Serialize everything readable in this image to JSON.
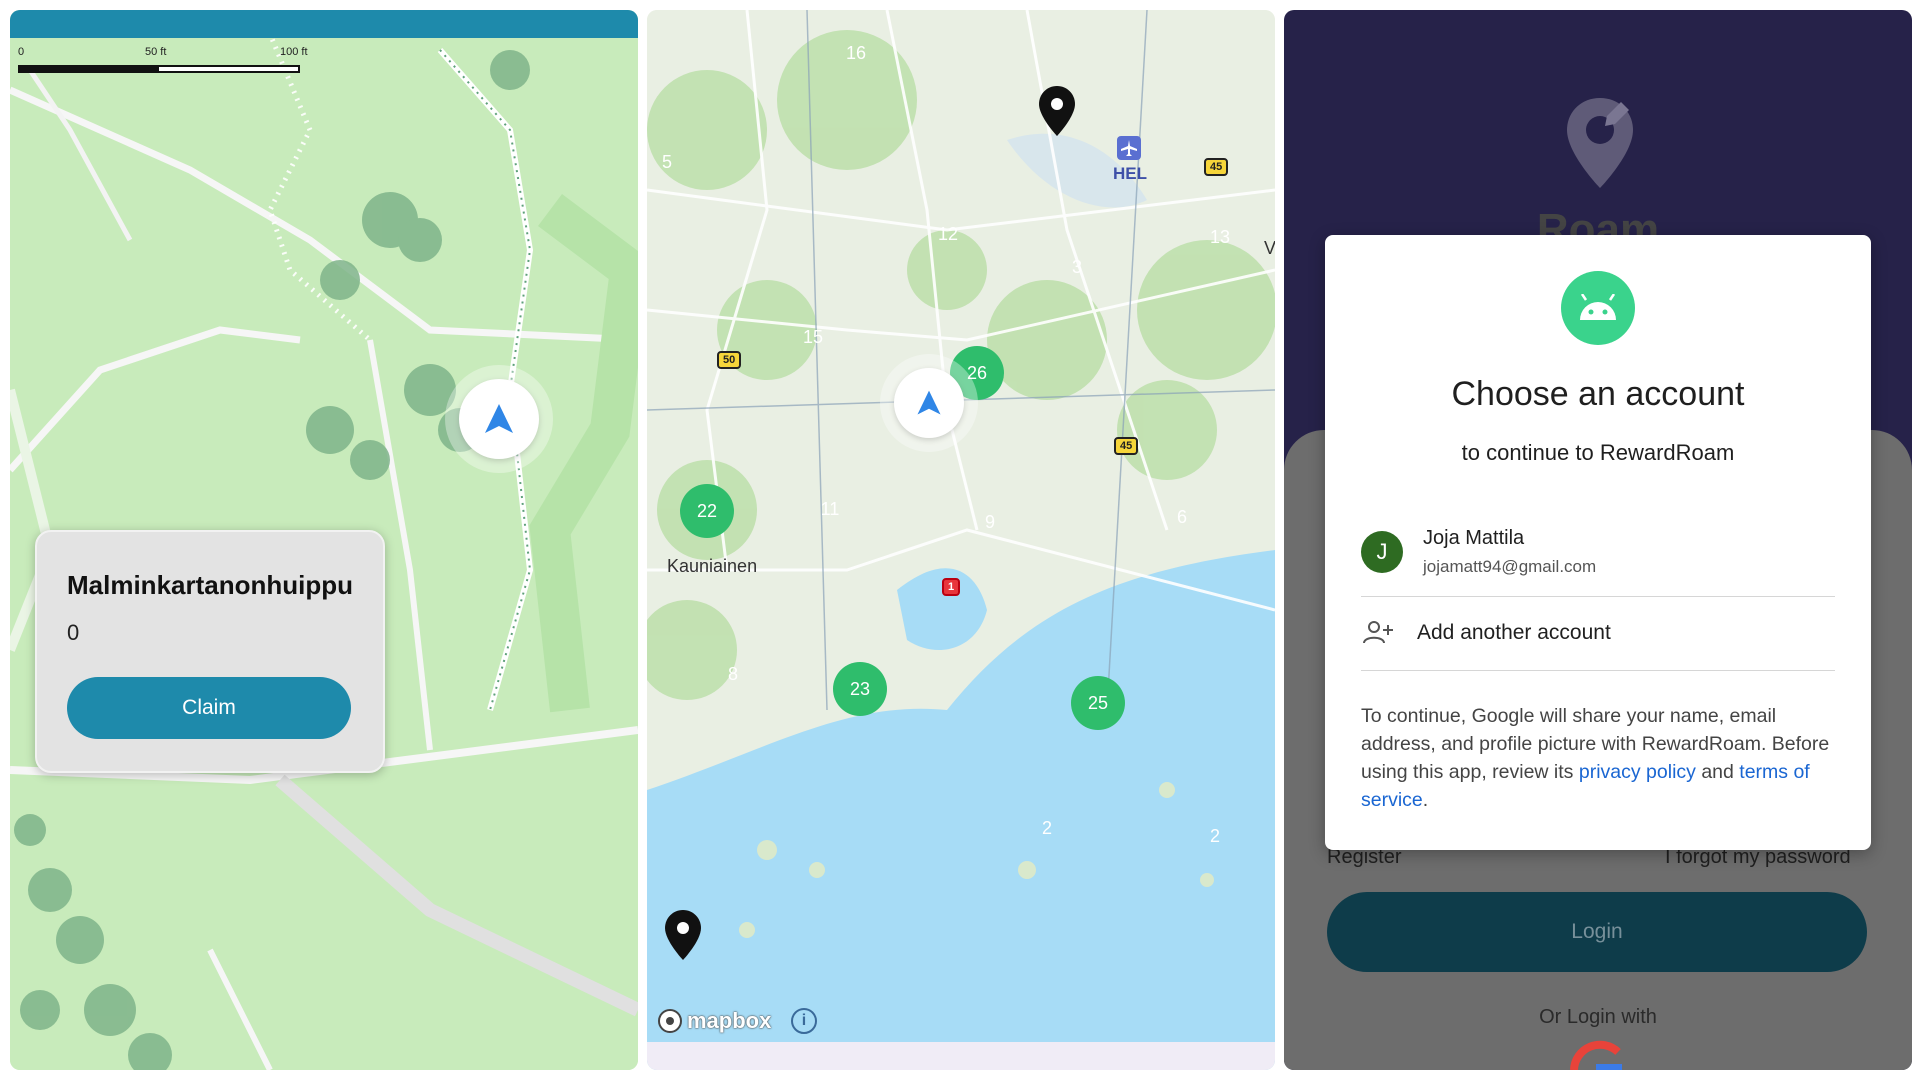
{
  "map_panel": {
    "scale": {
      "zero": "0",
      "mid": "50 ft",
      "max": "100 ft"
    },
    "poi_card": {
      "title": "Malminkartanonhuippu",
      "count": "0",
      "claim_label": "Claim"
    }
  },
  "cluster_panel": {
    "clusters": [
      {
        "count": "16",
        "color": "blue"
      },
      {
        "count": "5",
        "color": "blue"
      },
      {
        "count": "12",
        "color": "blue"
      },
      {
        "count": "3",
        "color": "blue"
      },
      {
        "count": "13",
        "color": "blue"
      },
      {
        "count": "15",
        "color": "blue"
      },
      {
        "count": "26",
        "color": "green"
      },
      {
        "count": "22",
        "color": "green"
      },
      {
        "count": "11",
        "color": "blue"
      },
      {
        "count": "9",
        "color": "blue"
      },
      {
        "count": "6",
        "color": "blue"
      },
      {
        "count": "8",
        "color": "blue"
      },
      {
        "count": "23",
        "color": "green"
      },
      {
        "count": "25",
        "color": "green"
      },
      {
        "count": "2",
        "color": "blue"
      },
      {
        "count": "2",
        "color": "blue"
      }
    ],
    "labels": {
      "airport": "HEL",
      "town": "Kauniainen",
      "edge_label": "V"
    },
    "road_shields": {
      "r45a": "45",
      "r45b": "45",
      "r50": "50",
      "r1": "1"
    },
    "attribution": {
      "mapbox": "mapbox",
      "info": "i"
    }
  },
  "login_panel": {
    "app_name": "Roam",
    "register": "Register",
    "forgot_password": "I forgot my password",
    "login_label": "Login",
    "or_login_with": "Or Login with",
    "dialog": {
      "title": "Choose an account",
      "subtitle": "to continue to RewardRoam",
      "account_initial": "J",
      "account_name": "Joja Mattila",
      "account_email": "jojamatt94@gmail.com",
      "add_account": "Add another account",
      "desc_1": "To continue, Google will share your name, email address, and profile picture with RewardRoam. Before using this app, review its ",
      "privacy_policy": "privacy policy",
      "desc_2": " and ",
      "terms": "terms of service",
      "desc_3": "."
    }
  },
  "colors": {
    "accent": "#1e8aab",
    "cluster_blue": "#1a7fa0",
    "cluster_green": "#2fbd6c",
    "dialog_icon": "#3ad38c",
    "link": "#1a66d2",
    "login_bg": "#0e3c4a"
  }
}
